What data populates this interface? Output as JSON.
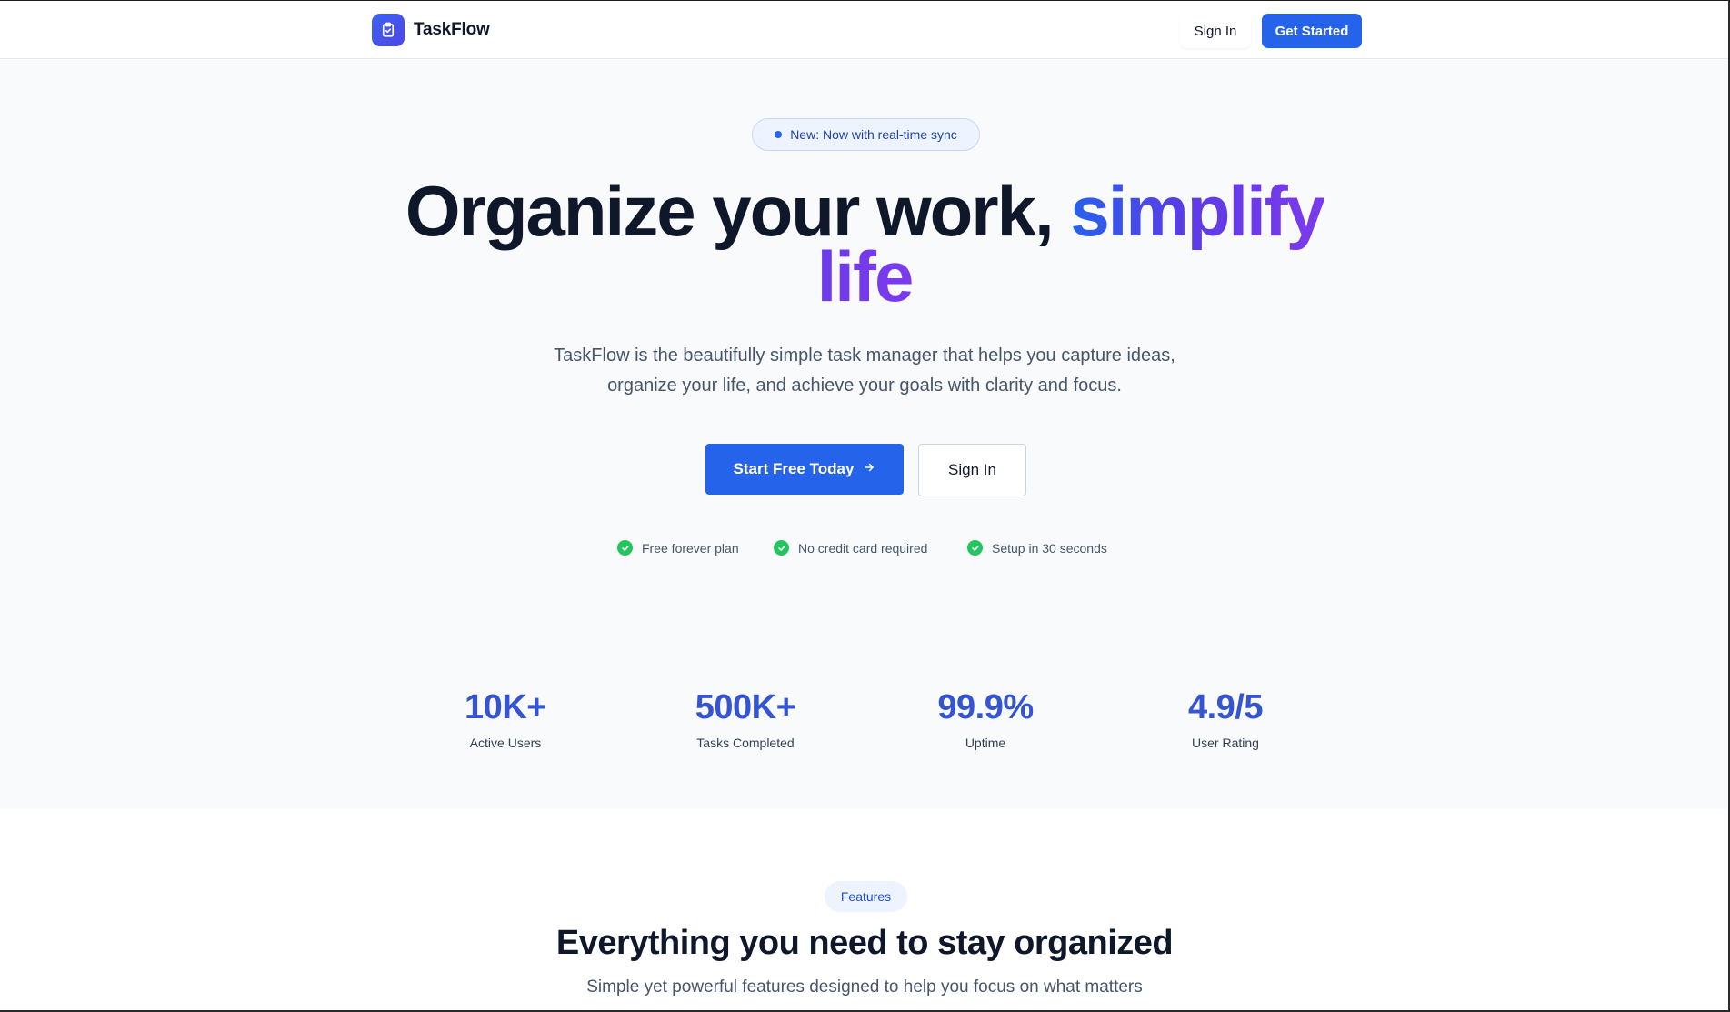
{
  "navbar": {
    "brand_name": "TaskFlow",
    "signin_label": "Sign In",
    "get_started_label": "Get Started"
  },
  "hero": {
    "badge_text": "New: Now with real-time sync",
    "title_part1": "Organize your work,",
    "title_highlight_1": "simplify",
    "title_highlight_2": "life",
    "subtitle": "TaskFlow is the beautifully simple task manager that helps you capture ideas, organize your life, and achieve your goals with clarity and focus.",
    "cta_primary": "Start Free Today",
    "cta_secondary": "Sign In",
    "perks": [
      "Free forever plan",
      "No credit card required",
      "Setup in 30 seconds"
    ]
  },
  "stats": [
    {
      "value": "10K+",
      "label": "Active Users"
    },
    {
      "value": "500K+",
      "label": "Tasks Completed"
    },
    {
      "value": "99.9%",
      "label": "Uptime"
    },
    {
      "value": "4.9/5",
      "label": "User Rating"
    }
  ],
  "features": {
    "pill": "Features",
    "title": "Everything you need to stay organized",
    "subtitle": "Simple yet powerful features designed to help you focus on what matters"
  },
  "colors": {
    "primary": "#2563eb",
    "accent_purple": "#7c3aed",
    "stat_blue": "#3454d1",
    "success": "#22c55e",
    "hero_background": "#f8fafc"
  },
  "icons": {
    "brand": "clipboard-check-icon",
    "badge": "dot-icon",
    "cta_primary": "arrow-right-icon",
    "perk": "check-circle-icon"
  }
}
